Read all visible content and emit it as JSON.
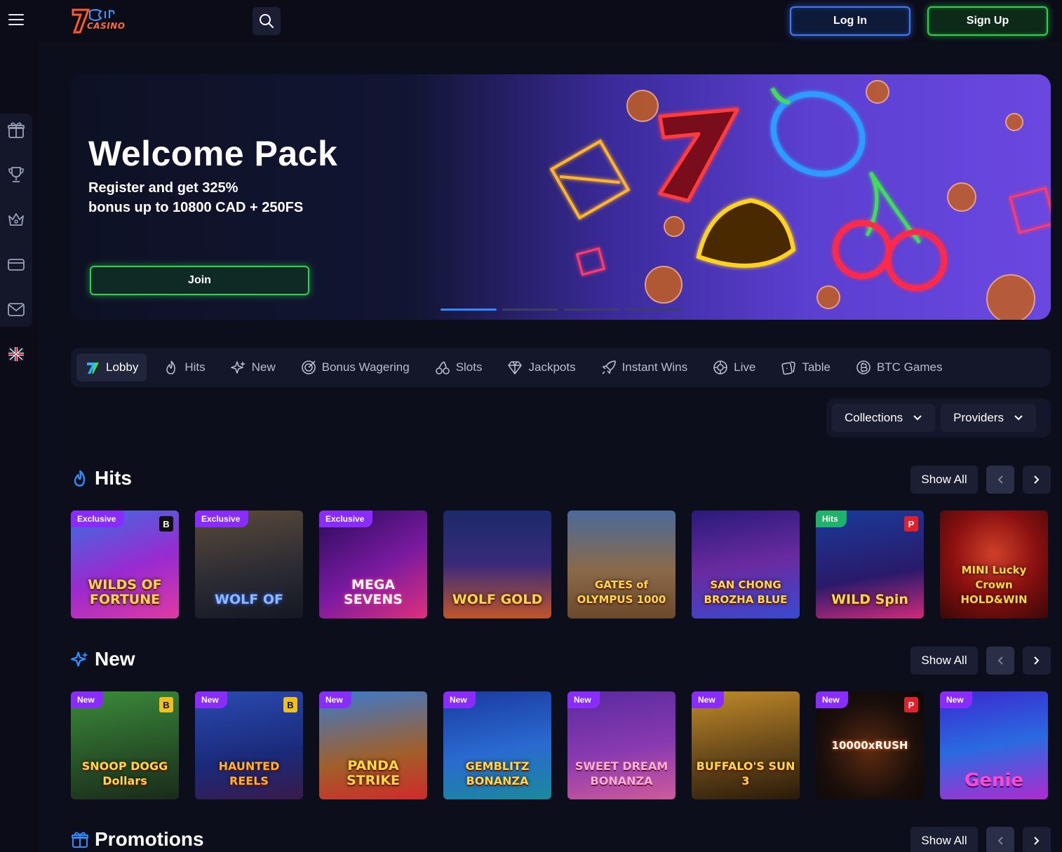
{
  "header": {
    "logo_text": "CASINO",
    "login_label": "Log In",
    "signup_label": "Sign Up"
  },
  "sidebar": {
    "icons": [
      "gift-icon",
      "trophy-icon",
      "crown-icon",
      "card-icon",
      "mail-icon",
      "language-flag-icon"
    ]
  },
  "hero": {
    "title": "Welcome Pack",
    "subtitle_line1": "Register and get 325%",
    "subtitle_line2": "bonus up to 10800 CAD + 250FS",
    "join_label": "Join",
    "slides": 4,
    "active_slide": 0
  },
  "categories": [
    {
      "label": "Lobby",
      "icon": "lobby-logo-icon",
      "active": true
    },
    {
      "label": "Hits",
      "icon": "flame-icon"
    },
    {
      "label": "New",
      "icon": "sparkle-icon"
    },
    {
      "label": "Bonus Wagering",
      "icon": "target-icon"
    },
    {
      "label": "Slots",
      "icon": "cherry-icon"
    },
    {
      "label": "Jackpots",
      "icon": "diamond-icon"
    },
    {
      "label": "Instant Wins",
      "icon": "rocket-icon"
    },
    {
      "label": "Live",
      "icon": "chip-icon"
    },
    {
      "label": "Table",
      "icon": "cards-icon"
    },
    {
      "label": "BTC Games",
      "icon": "bitcoin-icon"
    }
  ],
  "filters": {
    "collections_label": "Collections",
    "providers_label": "Providers"
  },
  "sections": {
    "hits": {
      "title": "Hits",
      "show_all": "Show All",
      "games": [
        {
          "badge": "Exclusive",
          "title": "WILDS OF FORTUNE",
          "mark": "B"
        },
        {
          "badge": "Exclusive",
          "title": "WOLF OF",
          "mark": ""
        },
        {
          "badge": "Exclusive",
          "title": "MEGA SEVENS",
          "mark": ""
        },
        {
          "badge": "",
          "title": "WOLF GOLD",
          "mark": ""
        },
        {
          "badge": "",
          "title": "GATES of OLYMPUS 1000",
          "mark": ""
        },
        {
          "badge": "",
          "title": "SAN CHONG BROZHA BLUE",
          "mark": ""
        },
        {
          "badge": "Hits",
          "title": "WILD Spin",
          "mark": "P"
        },
        {
          "badge": "",
          "title": "MINI Lucky Crown HOLD&WIN",
          "mark": ""
        }
      ]
    },
    "new": {
      "title": "New",
      "show_all": "Show All",
      "games": [
        {
          "badge": "New",
          "title": "SNOOP DOGG Dollars",
          "mark": "B"
        },
        {
          "badge": "New",
          "title": "HAUNTED REELS",
          "mark": "B"
        },
        {
          "badge": "New",
          "title": "PANDA STRIKE",
          "mark": ""
        },
        {
          "badge": "New",
          "title": "GEMBLITZ BONANZA",
          "mark": ""
        },
        {
          "badge": "New",
          "title": "SWEET DREAM BONANZA",
          "mark": ""
        },
        {
          "badge": "New",
          "title": "BUFFALO'S SUN 3",
          "mark": ""
        },
        {
          "badge": "New",
          "title": "10000xRUSH",
          "mark": "P"
        },
        {
          "badge": "New",
          "title": "Genie",
          "mark": ""
        }
      ]
    },
    "promotions": {
      "title": "Promotions",
      "show_all": "Show All"
    }
  },
  "colors": {
    "background": "#0c0e1c",
    "panel": "#14172a",
    "login_border": "#3f7bff",
    "signup_border": "#29d54b",
    "badge_purple": "#8a2cff",
    "badge_green": "#1fb26b",
    "accent_blue": "#2f8cff"
  }
}
